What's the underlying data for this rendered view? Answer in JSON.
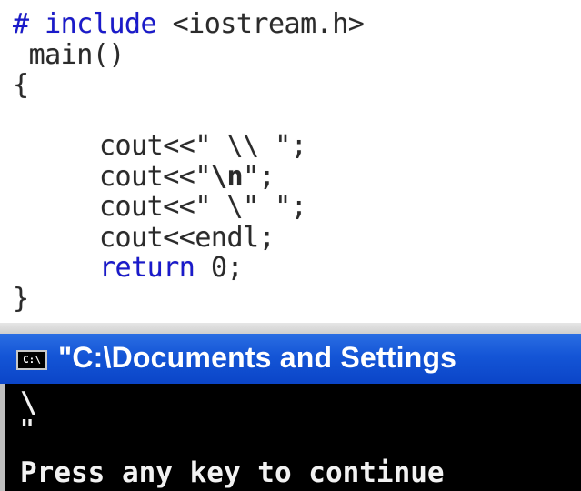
{
  "editor": {
    "lines": {
      "include_kw": "# include",
      "include_rest": "<iostream.h>",
      "main": "main()",
      "open_brace": "{",
      "cout1": "cout<<\" \\\\ \";",
      "cout2_a": "cout<<\"",
      "cout2_b": "\\n",
      "cout2_c": "\";",
      "cout3": "cout<<\" \\\" \";",
      "cout4": "cout<<endl;",
      "return_kw": "return",
      "return_rest": "0;",
      "close_brace": "}"
    }
  },
  "console": {
    "title": "\"C:\\Documents and Settings",
    "icon_label": "C:\\",
    "output": {
      "line1": "\\",
      "line2": "\"",
      "line3": "Press any key to continue"
    }
  },
  "colors": {
    "keyword": "#1a1acb",
    "titlebar": "#1455d6",
    "console_bg": "#000000"
  }
}
